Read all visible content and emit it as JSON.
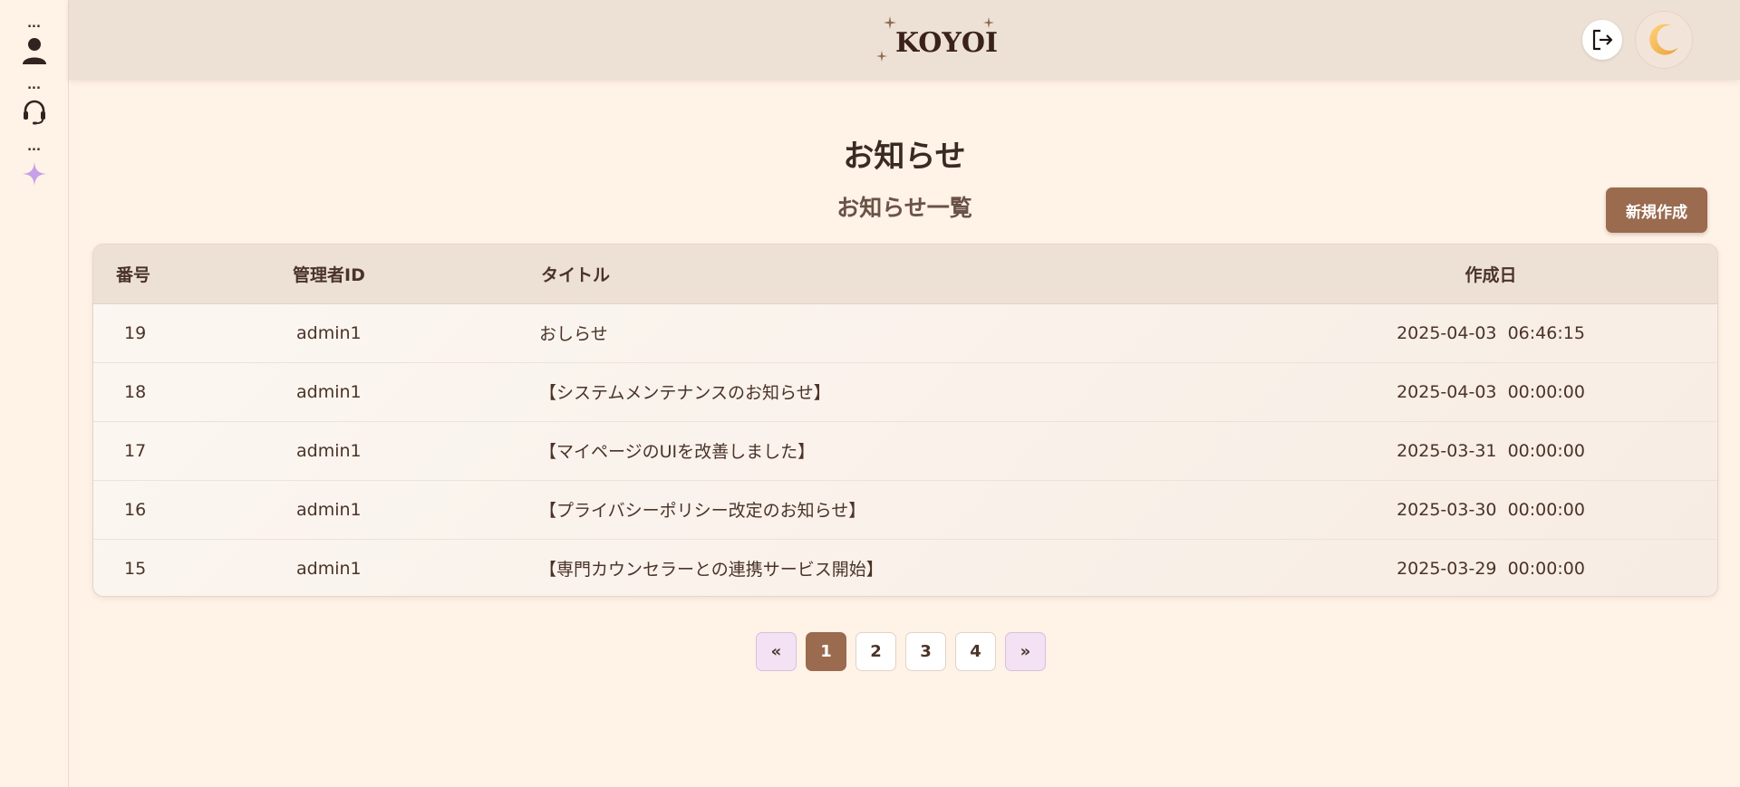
{
  "sidebar": {
    "items": [
      {
        "dots": "...",
        "icon": "user-icon"
      },
      {
        "dots": "...",
        "icon": "headset-icon"
      },
      {
        "dots": "...",
        "icon": "sparkle-icon"
      }
    ]
  },
  "header": {
    "logo_text": "KOYOI",
    "logout_icon": "logout-icon",
    "theme_icon": "crescent-moon-icon"
  },
  "main": {
    "title": "お知らせ",
    "subtitle": "お知らせ一覧",
    "new_button_label": "新規作成",
    "table": {
      "columns": [
        "番号",
        "管理者ID",
        "タイトル",
        "作成日"
      ],
      "rows": [
        {
          "id": "19",
          "admin": "admin1",
          "title": "おしらせ",
          "created": "2025-04-03  06:46:15"
        },
        {
          "id": "18",
          "admin": "admin1",
          "title": "【システムメンテナンスのお知らせ】",
          "created": "2025-04-03  00:00:00"
        },
        {
          "id": "17",
          "admin": "admin1",
          "title": "【マイページのUIを改善しました】",
          "created": "2025-03-31  00:00:00"
        },
        {
          "id": "16",
          "admin": "admin1",
          "title": "【プライバシーポリシー改定のお知らせ】",
          "created": "2025-03-30  00:00:00"
        },
        {
          "id": "15",
          "admin": "admin1",
          "title": "【専門カウンセラーとの連携サービス開始】",
          "created": "2025-03-29  00:00:00"
        }
      ]
    },
    "pagination": {
      "prev": "«",
      "pages": [
        "1",
        "2",
        "3",
        "4"
      ],
      "current": "1",
      "next": "»"
    }
  },
  "colors": {
    "background": "#fff2e6",
    "header": "#ede0d4",
    "accent_brown": "#9a6b4f",
    "sparkle_purple": "#c6a0e8",
    "arrow_button": "#f2e2f4"
  }
}
